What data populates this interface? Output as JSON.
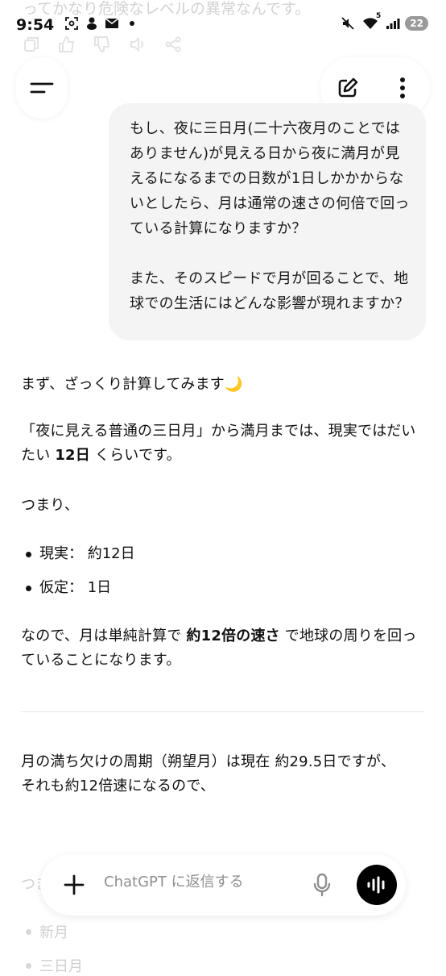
{
  "status_bar": {
    "ghost_text": "ってかなり危険なレベルの異常なんです。",
    "time": "9:54",
    "left_icons": [
      "screenshot-icon",
      "app-icon",
      "mail-icon",
      "dot-icon"
    ],
    "right_icons": [
      "mute-icon",
      "wifi-icon",
      "signal-icon"
    ],
    "wifi_badge": "5",
    "battery": "22"
  },
  "header": {
    "menu_icon": "menu-icon",
    "new_chat_icon": "edit-icon",
    "more_icon": "more-vertical-icon"
  },
  "user_message": {
    "paragraph1": "もし、夜に三日月(二十六夜月のことではありません)が見える日から夜に満月が見えるになるまでの日数が1日しかかからないとしたら、月は通常の速さの何倍で回っている計算になりますか？",
    "paragraph2": "また、そのスピードで月が回ることで、地球での生活にはどんな影響が現れますか？"
  },
  "assistant_message": {
    "intro": "まず、ざっくり計算してみます🌙",
    "p2_pre": "「夜に見える普通の三日月」から満月までは、現実ではだいたい ",
    "p2_bold": "12日",
    "p2_post": " くらいです。",
    "p3": "つまり、",
    "bullets": [
      "現実： 約12日",
      "仮定： 1日"
    ],
    "p4_pre": "なので、月は単純計算で ",
    "p4_bold": "約12倍の速さ",
    "p4_post": " で地球の周りを回っていることになります。",
    "p5_line1": "月の満ち欠けの周期（朔望月）は現在 約29.5日ですが、",
    "p5_line2": "それも約12倍速になるので、",
    "behind_text": "つま",
    "behind_bullets": [
      "新月",
      "三日月"
    ]
  },
  "composer": {
    "placeholder": "ChatGPT に返信する",
    "icons": [
      "plus-icon",
      "microphone-icon",
      "voice-mode-icon"
    ]
  }
}
